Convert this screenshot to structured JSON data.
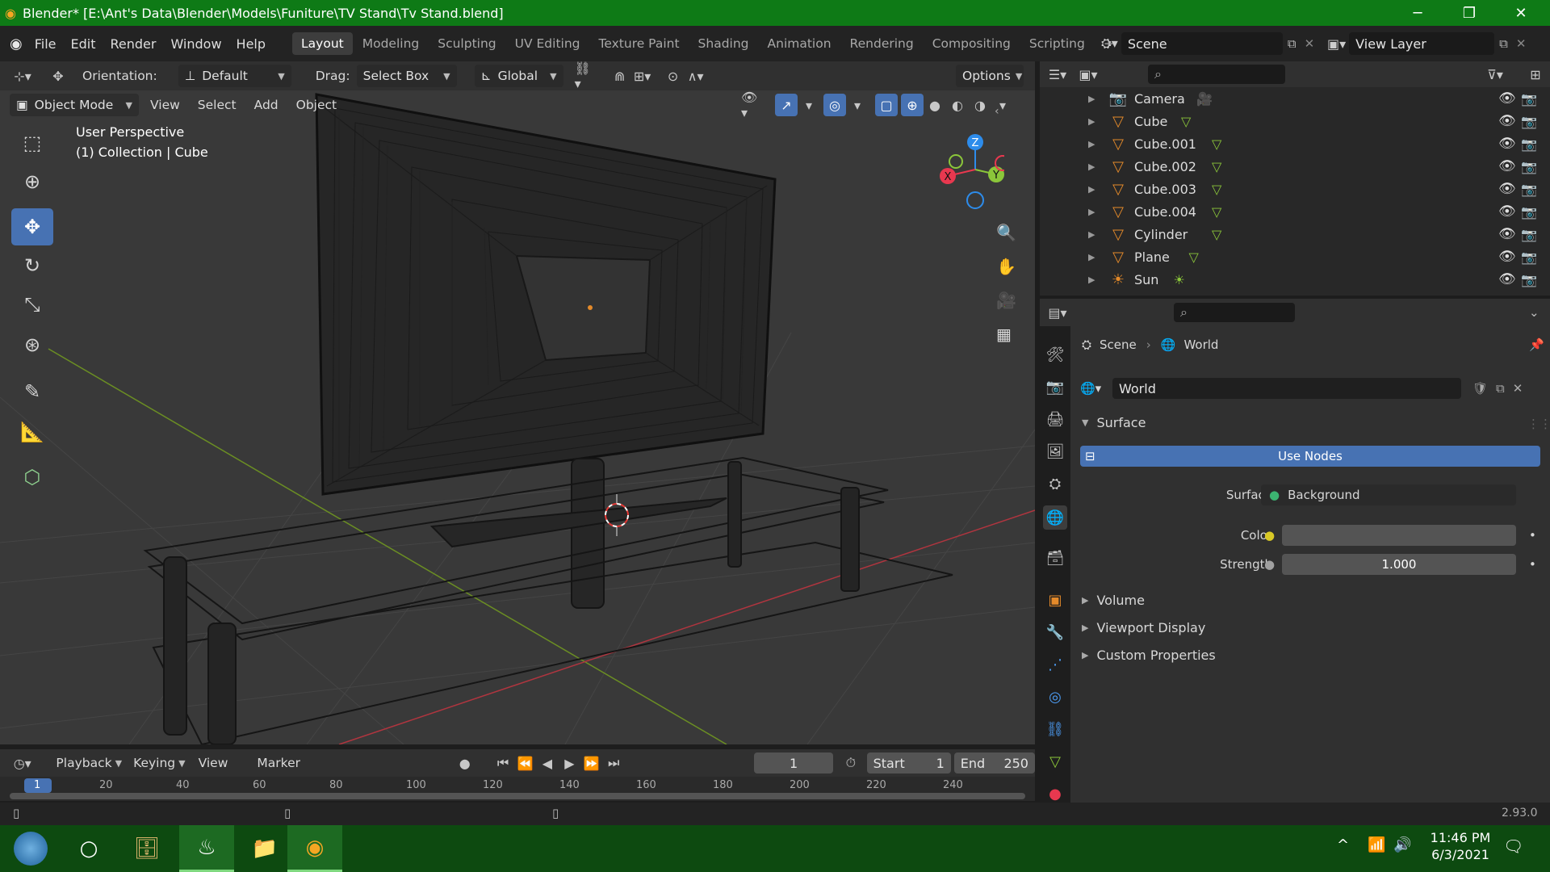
{
  "window": {
    "title": "Blender* [E:\\Ant's Data\\Blender\\Models\\Funiture\\TV Stand\\Tv Stand.blend]",
    "minimize": "─",
    "maximize": "❐",
    "close": "✕"
  },
  "menu": {
    "items": [
      "File",
      "Edit",
      "Render",
      "Window",
      "Help"
    ],
    "workspaces": [
      "Layout",
      "Modeling",
      "Sculpting",
      "UV Editing",
      "Texture Paint",
      "Shading",
      "Animation",
      "Rendering",
      "Compositing",
      "Scripting"
    ],
    "active_workspace": "Layout",
    "add_tab": "+",
    "scene_name": "Scene",
    "view_layer": "View Layer"
  },
  "viewport_header": {
    "orientation_label": "Orientation:",
    "orientation_value": "Default",
    "drag_label": "Drag:",
    "drag_value": "Select Box",
    "transform_value": "Global",
    "options": "Options",
    "mode": "Object Mode",
    "menus": [
      "View",
      "Select",
      "Add",
      "Object"
    ]
  },
  "viewport": {
    "view_name": "User Perspective",
    "collection_info": "(1) Collection | Cube",
    "gizmo": {
      "x": "X",
      "y": "Y",
      "z": "Z"
    }
  },
  "outliner": {
    "items": [
      {
        "name": "Camera",
        "icon": "camera-icon"
      },
      {
        "name": "Cube",
        "icon": "mesh-icon"
      },
      {
        "name": "Cube.001",
        "icon": "mesh-icon"
      },
      {
        "name": "Cube.002",
        "icon": "mesh-icon"
      },
      {
        "name": "Cube.003",
        "icon": "mesh-icon"
      },
      {
        "name": "Cube.004",
        "icon": "mesh-icon"
      },
      {
        "name": "Cylinder",
        "icon": "mesh-icon"
      },
      {
        "name": "Plane",
        "icon": "mesh-icon"
      },
      {
        "name": "Sun",
        "icon": "light-icon"
      }
    ]
  },
  "properties": {
    "breadcrumb_scene": "Scene",
    "breadcrumb_world": "World",
    "world_name": "World",
    "surface_panel": "Surface",
    "use_nodes": "Use Nodes",
    "surface_label": "Surface",
    "surface_value": "Background",
    "color_label": "Color",
    "strength_label": "Strength",
    "strength_value": "1.000",
    "collapsed_panels": [
      "Volume",
      "Viewport Display",
      "Custom Properties"
    ]
  },
  "timeline": {
    "menus": [
      "Playback",
      "Keying",
      "View",
      "Marker"
    ],
    "current_frame": "1",
    "start_label": "Start",
    "start_value": "1",
    "end_label": "End",
    "end_value": "250",
    "ruler_marks": [
      "1",
      "20",
      "40",
      "60",
      "80",
      "100",
      "120",
      "140",
      "160",
      "180",
      "200",
      "220",
      "240"
    ]
  },
  "status": {
    "version": "2.93.0"
  },
  "taskbar": {
    "time": "11:46 PM",
    "date": "6/3/2021"
  },
  "colors": {
    "accent": "#4772b3",
    "titlebar": "#0e7a16",
    "object_orange": "#e48a2a",
    "x_axis": "#e8384f",
    "y_axis": "#8bc63a",
    "z_axis": "#2d8ceb"
  }
}
